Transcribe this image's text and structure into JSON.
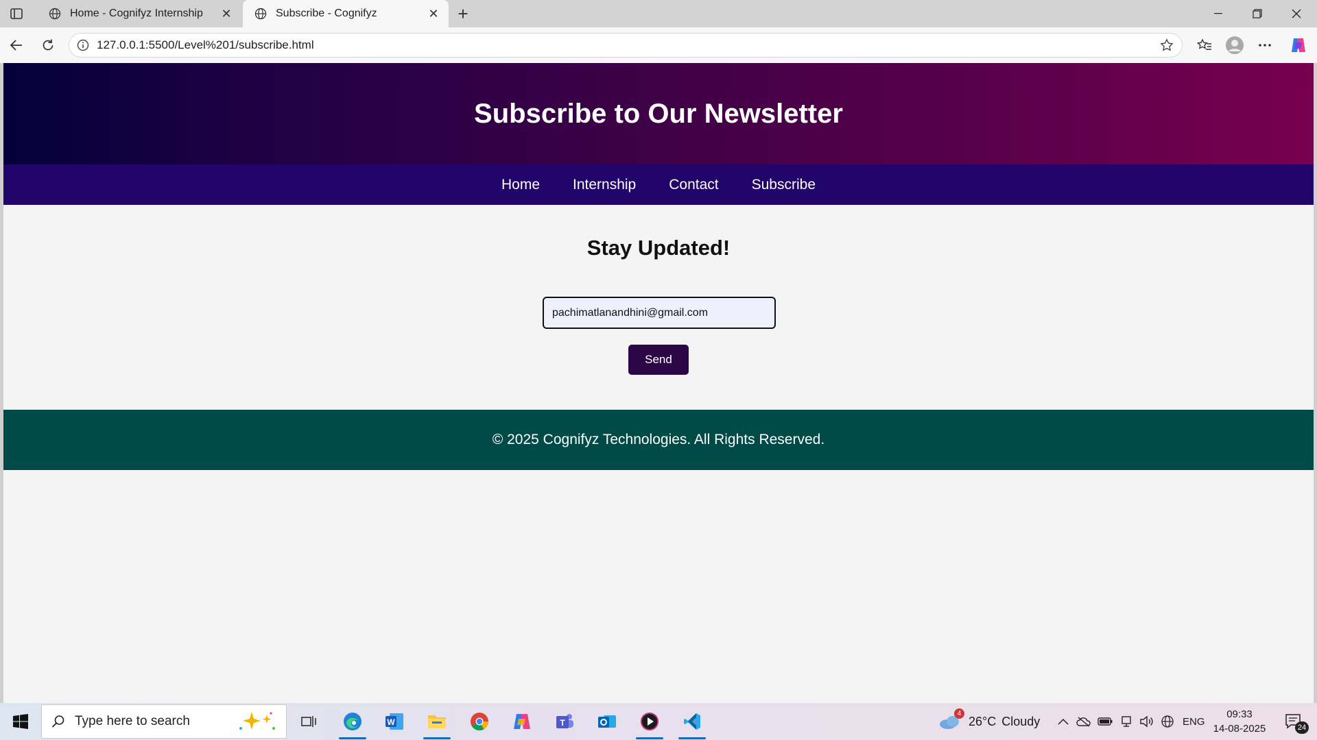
{
  "browser": {
    "tabs": [
      {
        "title": "Home - Cognifyz Internship",
        "active": false
      },
      {
        "title": "Subscribe - Cognifyz",
        "active": true
      }
    ],
    "address_url": "127.0.0.1:5500/Level%201/subscribe.html"
  },
  "page": {
    "header_title": "Subscribe to Our Newsletter",
    "nav": [
      "Home",
      "Internship",
      "Contact",
      "Subscribe"
    ],
    "section_title": "Stay Updated!",
    "email_value": "pachimatlanandhini@gmail.com",
    "send_label": "Send",
    "footer_text": "© 2025 Cognifyz Technologies. All Rights Reserved."
  },
  "colors": {
    "header_gradient_start": "#03013a",
    "header_gradient_end": "#77004f",
    "nav_bg": "#22056b",
    "button_bg": "#2b0745",
    "footer_bg": "#004a47"
  },
  "taskbar": {
    "search_placeholder": "Type here to search",
    "weather_temp": "26°C",
    "weather_text": "Cloudy",
    "weather_badge": "4",
    "language": "ENG",
    "time": "09:33",
    "date": "14-08-2025",
    "notification_count": "24",
    "apps": [
      "edge-icon",
      "word-icon",
      "file-explorer-icon",
      "chrome-icon",
      "copilot-icon",
      "teams-icon",
      "outlook-icon",
      "media-player-icon",
      "vscode-icon"
    ]
  }
}
